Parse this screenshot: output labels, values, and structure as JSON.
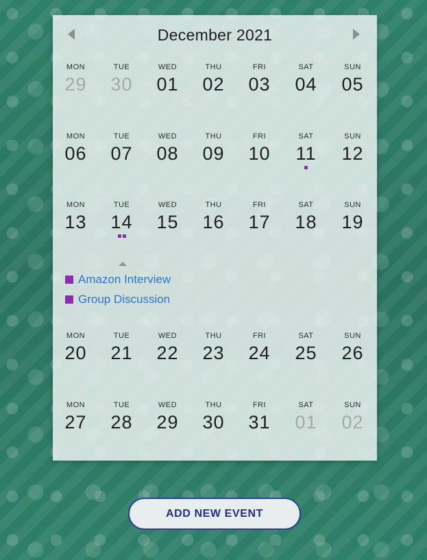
{
  "header": {
    "month_label": "December 2021"
  },
  "weeks": [
    [
      {
        "dow": "MON",
        "day": "29",
        "other": true,
        "dots": 0
      },
      {
        "dow": "TUE",
        "day": "30",
        "other": true,
        "dots": 0
      },
      {
        "dow": "WED",
        "day": "01",
        "other": false,
        "dots": 0
      },
      {
        "dow": "THU",
        "day": "02",
        "other": false,
        "dots": 0
      },
      {
        "dow": "FRI",
        "day": "03",
        "other": false,
        "dots": 0
      },
      {
        "dow": "SAT",
        "day": "04",
        "other": false,
        "dots": 0
      },
      {
        "dow": "SUN",
        "day": "05",
        "other": false,
        "dots": 0
      }
    ],
    [
      {
        "dow": "MON",
        "day": "06",
        "other": false,
        "dots": 0
      },
      {
        "dow": "TUE",
        "day": "07",
        "other": false,
        "dots": 0
      },
      {
        "dow": "WED",
        "day": "08",
        "other": false,
        "dots": 0
      },
      {
        "dow": "THU",
        "day": "09",
        "other": false,
        "dots": 0
      },
      {
        "dow": "FRI",
        "day": "10",
        "other": false,
        "dots": 0
      },
      {
        "dow": "SAT",
        "day": "11",
        "other": false,
        "dots": 1
      },
      {
        "dow": "SUN",
        "day": "12",
        "other": false,
        "dots": 0
      }
    ],
    [
      {
        "dow": "MON",
        "day": "13",
        "other": false,
        "dots": 0
      },
      {
        "dow": "TUE",
        "day": "14",
        "other": false,
        "dots": 2
      },
      {
        "dow": "WED",
        "day": "15",
        "other": false,
        "dots": 0
      },
      {
        "dow": "THU",
        "day": "16",
        "other": false,
        "dots": 0
      },
      {
        "dow": "FRI",
        "day": "17",
        "other": false,
        "dots": 0
      },
      {
        "dow": "SAT",
        "day": "18",
        "other": false,
        "dots": 0
      },
      {
        "dow": "SUN",
        "day": "19",
        "other": false,
        "dots": 0
      }
    ],
    [
      {
        "dow": "MON",
        "day": "20",
        "other": false,
        "dots": 0
      },
      {
        "dow": "TUE",
        "day": "21",
        "other": false,
        "dots": 0
      },
      {
        "dow": "WED",
        "day": "22",
        "other": false,
        "dots": 0
      },
      {
        "dow": "THU",
        "day": "23",
        "other": false,
        "dots": 0
      },
      {
        "dow": "FRI",
        "day": "24",
        "other": false,
        "dots": 0
      },
      {
        "dow": "SAT",
        "day": "25",
        "other": false,
        "dots": 0
      },
      {
        "dow": "SUN",
        "day": "26",
        "other": false,
        "dots": 0
      }
    ],
    [
      {
        "dow": "MON",
        "day": "27",
        "other": false,
        "dots": 0
      },
      {
        "dow": "TUE",
        "day": "28",
        "other": false,
        "dots": 0
      },
      {
        "dow": "WED",
        "day": "29",
        "other": false,
        "dots": 0
      },
      {
        "dow": "THU",
        "day": "30",
        "other": false,
        "dots": 0
      },
      {
        "dow": "FRI",
        "day": "31",
        "other": false,
        "dots": 0
      },
      {
        "dow": "SAT",
        "day": "01",
        "other": true,
        "dots": 0
      },
      {
        "dow": "SUN",
        "day": "02",
        "other": true,
        "dots": 0
      }
    ]
  ],
  "selected_day_events": [
    {
      "title": "Amazon Interview",
      "color": "#8a2fb0"
    },
    {
      "title": "Group Discussion",
      "color": "#8a2fb0"
    }
  ],
  "icons": {
    "prev": "chevron-left-icon",
    "next": "chevron-right-icon",
    "event_marker": "square-icon"
  },
  "actions": {
    "add_event_label": "ADD NEW EVENT"
  },
  "colors": {
    "event_color": "#8a2fb0",
    "event_link": "#2f74c8",
    "button_text": "#1e2f86"
  }
}
